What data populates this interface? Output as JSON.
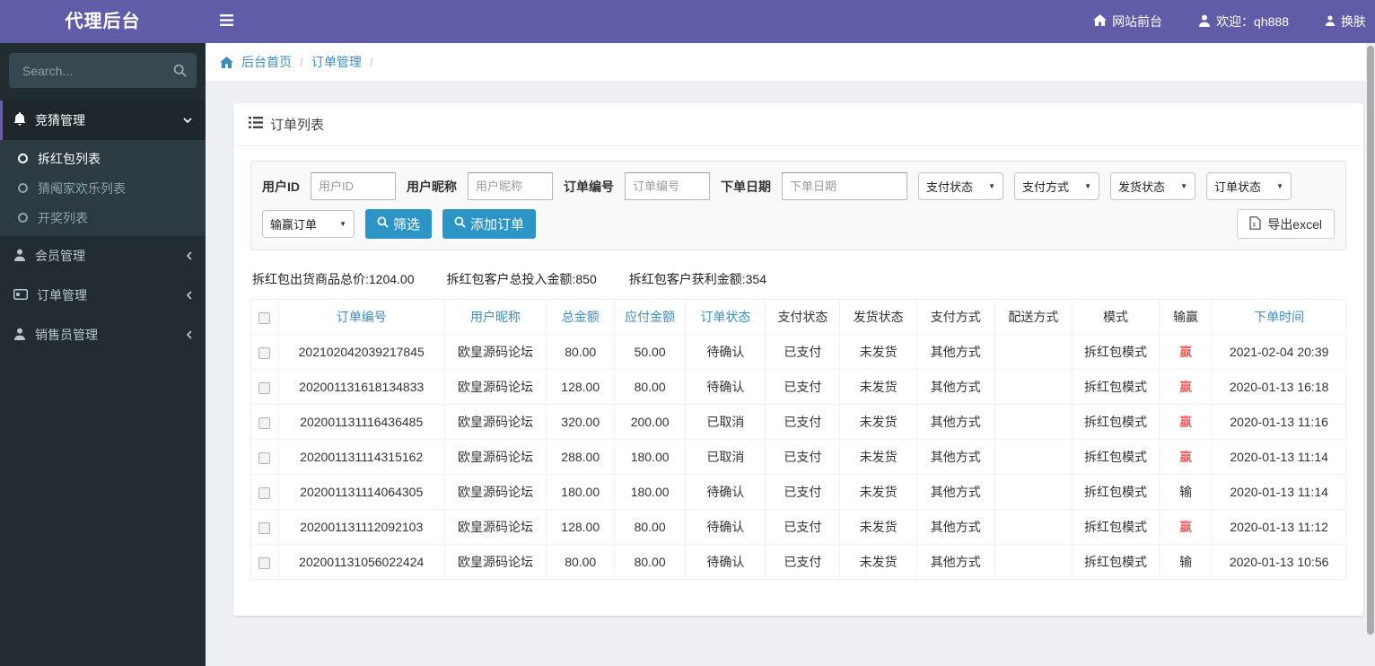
{
  "app": {
    "title": "代理后台"
  },
  "header": {
    "frontend_link": "网站前台",
    "welcome": "欢迎：qh888",
    "change_skin": "换肤"
  },
  "sidebar": {
    "search_placeholder": "Search...",
    "menu": [
      {
        "label": "竞猜管理",
        "state": "expanded",
        "children": [
          "拆红包列表",
          "猜阄家欢乐列表",
          "开奖列表"
        ]
      },
      {
        "label": "会员管理",
        "state": "collapsed"
      },
      {
        "label": "订单管理",
        "state": "collapsed"
      },
      {
        "label": "销售员管理",
        "state": "collapsed"
      }
    ]
  },
  "breadcrumb": {
    "home": "后台首页",
    "current": "订单管理",
    "separator": "/"
  },
  "panel": {
    "title": "订单列表"
  },
  "filters": {
    "inputs": [
      {
        "label": "用户ID",
        "placeholder": "用户ID"
      },
      {
        "label": "用户昵称",
        "placeholder": "用户昵称"
      },
      {
        "label": "订单编号",
        "placeholder": "订单编号"
      },
      {
        "label": "下单日期",
        "placeholder": "下单日期"
      }
    ],
    "selects": [
      "支付状态",
      "支付方式",
      "发货状态",
      "订单状态"
    ],
    "winlose_select": "输赢订单",
    "filter_button": "筛选",
    "add_button": "添加订单",
    "export_button": "导出excel"
  },
  "summary": [
    "拆红包出货商品总价:1204.00",
    "拆红包客户总投入金额:850",
    "拆红包客户获利金额:354"
  ],
  "table": {
    "win_label": "赢",
    "lose_label": "输",
    "headers": [
      {
        "label": "订单编号",
        "link": true
      },
      {
        "label": "用户昵称",
        "link": true
      },
      {
        "label": "总金额",
        "link": true
      },
      {
        "label": "应付金额",
        "link": true
      },
      {
        "label": "订单状态",
        "link": true
      },
      {
        "label": "支付状态",
        "link": false
      },
      {
        "label": "发货状态",
        "link": false
      },
      {
        "label": "支付方式",
        "link": false
      },
      {
        "label": "配送方式",
        "link": false
      },
      {
        "label": "模式",
        "link": false
      },
      {
        "label": "输赢",
        "link": false
      },
      {
        "label": "下单时间",
        "link": true
      }
    ],
    "rows": [
      {
        "order_no": "202102042039217845",
        "nickname": "欧皇源码论坛",
        "total": "80.00",
        "payable": "50.00",
        "order_status": "待确认",
        "pay_status": "已支付",
        "ship_status": "未发货",
        "pay_method": "其他方式",
        "delivery": "",
        "mode": "拆红包模式",
        "result": "赢",
        "time": "2021-02-04 20:39"
      },
      {
        "order_no": "202001131618134833",
        "nickname": "欧皇源码论坛",
        "total": "128.00",
        "payable": "80.00",
        "order_status": "待确认",
        "pay_status": "已支付",
        "ship_status": "未发货",
        "pay_method": "其他方式",
        "delivery": "",
        "mode": "拆红包模式",
        "result": "赢",
        "time": "2020-01-13 16:18"
      },
      {
        "order_no": "202001131116436485",
        "nickname": "欧皇源码论坛",
        "total": "320.00",
        "payable": "200.00",
        "order_status": "已取消",
        "pay_status": "已支付",
        "ship_status": "未发货",
        "pay_method": "其他方式",
        "delivery": "",
        "mode": "拆红包模式",
        "result": "赢",
        "time": "2020-01-13 11:16"
      },
      {
        "order_no": "202001131114315162",
        "nickname": "欧皇源码论坛",
        "total": "288.00",
        "payable": "180.00",
        "order_status": "已取消",
        "pay_status": "已支付",
        "ship_status": "未发货",
        "pay_method": "其他方式",
        "delivery": "",
        "mode": "拆红包模式",
        "result": "赢",
        "time": "2020-01-13 11:14"
      },
      {
        "order_no": "202001131114064305",
        "nickname": "欧皇源码论坛",
        "total": "180.00",
        "payable": "180.00",
        "order_status": "待确认",
        "pay_status": "已支付",
        "ship_status": "未发货",
        "pay_method": "其他方式",
        "delivery": "",
        "mode": "拆红包模式",
        "result": "输",
        "time": "2020-01-13 11:14"
      },
      {
        "order_no": "202001131112092103",
        "nickname": "欧皇源码论坛",
        "total": "128.00",
        "payable": "80.00",
        "order_status": "待确认",
        "pay_status": "已支付",
        "ship_status": "未发货",
        "pay_method": "其他方式",
        "delivery": "",
        "mode": "拆红包模式",
        "result": "赢",
        "time": "2020-01-13 11:12"
      },
      {
        "order_no": "202001131056022424",
        "nickname": "欧皇源码论坛",
        "total": "80.00",
        "payable": "80.00",
        "order_status": "待确认",
        "pay_status": "已支付",
        "ship_status": "未发货",
        "pay_method": "其他方式",
        "delivery": "",
        "mode": "拆红包模式",
        "result": "输",
        "time": "2020-01-13 10:56"
      }
    ]
  },
  "ui": {
    "caret": "▼"
  },
  "colors": {
    "header_purple": "#605ca8",
    "sidebar_dark": "#222d32",
    "submenu_dark": "#2c3b41",
    "link_blue": "#3c8dbc",
    "button_blue": "#2d95c5",
    "win_red": "#f01414",
    "content_bg": "#ecf0f5"
  },
  "icons": {
    "hamburger-icon": "three-bars",
    "home-icon": "house",
    "user-icon": "person",
    "skin-icon": "person",
    "search-icon": "magnifier",
    "bell-icon": "bell",
    "circle-icon": "circle-outline",
    "members-icon": "person",
    "orders-icon": "card",
    "sales-icon": "person",
    "list-icon": "list-lines",
    "excel-icon": "document-x",
    "chevron-down-icon": "v",
    "chevron-left-icon": "<"
  }
}
